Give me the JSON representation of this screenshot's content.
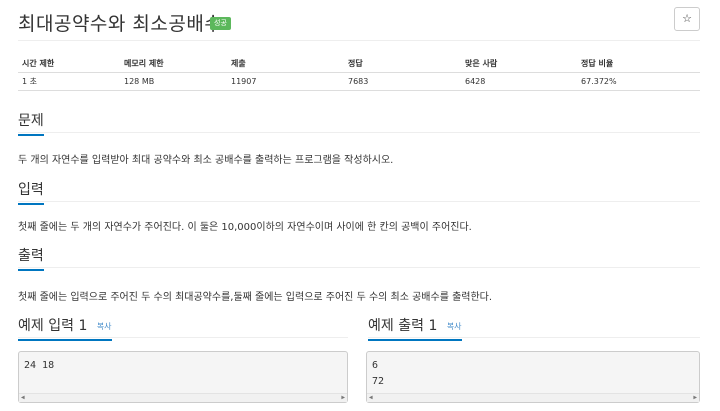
{
  "problem": {
    "title": "최대공약수와 최소공배수",
    "badge": "성공",
    "star": "☆"
  },
  "stats": {
    "headers": [
      "시간 제한",
      "메모리 제한",
      "제출",
      "정답",
      "맞은 사람",
      "정답 비율"
    ],
    "values": [
      "1 초",
      "128 MB",
      "11907",
      "7683",
      "6428",
      "67.372%"
    ]
  },
  "sections": {
    "problem": {
      "heading": "문제",
      "text": "두 개의 자연수를 입력받아 최대 공약수와 최소 공배수를 출력하는 프로그램을 작성하시오."
    },
    "input": {
      "heading": "입력",
      "text": "첫째 줄에는 두 개의 자연수가 주어진다. 이 둘은 10,000이하의 자연수이며 사이에 한 칸의 공백이 주어진다."
    },
    "output": {
      "heading": "출력",
      "text": "첫째 줄에는 입력으로 주어진 두 수의 최대공약수를,둘째 줄에는 입력으로 주어진 두 수의 최소 공배수를 출력한다."
    }
  },
  "samples": {
    "input": {
      "heading": "예제 입력",
      "number": "1",
      "copy": "복사",
      "lines": [
        "24 18"
      ]
    },
    "output": {
      "heading": "예제 출력",
      "number": "1",
      "copy": "복사",
      "lines": [
        "6",
        "72"
      ]
    }
  },
  "colors": {
    "accent": "#0076c0",
    "badge": "#5cb85c",
    "link": "#428bca"
  }
}
